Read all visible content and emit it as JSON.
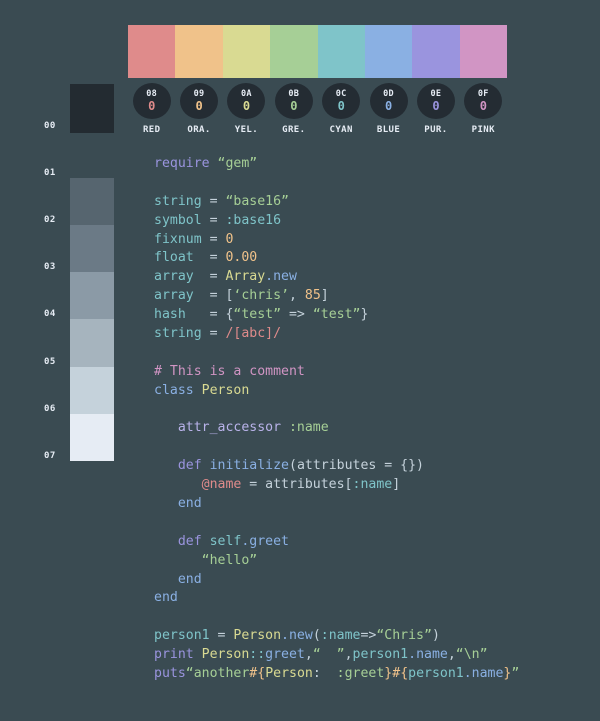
{
  "theme": {
    "background": "#3a4b52",
    "badge_bg": "#242c33",
    "label_color": "#e6ecf4"
  },
  "palette": {
    "accent_swatches": [
      {
        "hex_id": "08",
        "name": "RED",
        "zero": "0",
        "color": "#df8b8b"
      },
      {
        "hex_id": "09",
        "name": "ORA.",
        "zero": "0",
        "color": "#f0c28a"
      },
      {
        "hex_id": "0A",
        "name": "YEL.",
        "zero": "0",
        "color": "#d9da92"
      },
      {
        "hex_id": "0B",
        "name": "GRE.",
        "zero": "0",
        "color": "#a6cf96"
      },
      {
        "hex_id": "0C",
        "name": "CYAN",
        "zero": "0",
        "color": "#7fc4c9"
      },
      {
        "hex_id": "0D",
        "name": "BLUE",
        "zero": "0",
        "color": "#8ab0e3"
      },
      {
        "hex_id": "0E",
        "name": "PUR.",
        "zero": "0",
        "color": "#9a94de"
      },
      {
        "hex_id": "0F",
        "name": "PINK",
        "zero": "0",
        "color": "#d195c4"
      }
    ],
    "grayscale_ramp": [
      {
        "hex_id": "00",
        "color": "#232b31"
      },
      {
        "hex_id": "01",
        "color": "#3a4b52"
      },
      {
        "hex_id": "02",
        "color": "#56656f"
      },
      {
        "hex_id": "03",
        "color": "#6b7a86"
      },
      {
        "hex_id": "04",
        "color": "#8b9aa6"
      },
      {
        "hex_id": "05",
        "color": "#a6b4be"
      },
      {
        "hex_id": "06",
        "color": "#c5d2db"
      },
      {
        "hex_id": "07",
        "color": "#e6ecf4"
      }
    ]
  },
  "code_sample": {
    "language": "ruby",
    "lines": [
      [
        {
          "t": "require ",
          "c": "#9a94de"
        },
        {
          "t": "“gem”",
          "c": "#a6cf96"
        }
      ],
      [],
      [
        {
          "t": "string",
          "c": "#7fc4c9"
        },
        {
          "t": " = ",
          "c": "#c5d2db"
        },
        {
          "t": "“base16”",
          "c": "#a6cf96"
        }
      ],
      [
        {
          "t": "symbol",
          "c": "#7fc4c9"
        },
        {
          "t": " = ",
          "c": "#c5d2db"
        },
        {
          "t": ":base16",
          "c": "#7fc4c9"
        }
      ],
      [
        {
          "t": "fixnum",
          "c": "#7fc4c9"
        },
        {
          "t": " = ",
          "c": "#c5d2db"
        },
        {
          "t": "0",
          "c": "#f0c28a"
        }
      ],
      [
        {
          "t": "float",
          "c": "#7fc4c9"
        },
        {
          "t": "  = ",
          "c": "#c5d2db"
        },
        {
          "t": "0.00",
          "c": "#f0c28a"
        }
      ],
      [
        {
          "t": "array",
          "c": "#7fc4c9"
        },
        {
          "t": "  = ",
          "c": "#c5d2db"
        },
        {
          "t": "Array",
          "c": "#d9da92"
        },
        {
          "t": ".new",
          "c": "#8ab0e3"
        }
      ],
      [
        {
          "t": "array",
          "c": "#7fc4c9"
        },
        {
          "t": "  = [",
          "c": "#c5d2db"
        },
        {
          "t": "‘chris’",
          "c": "#a6cf96"
        },
        {
          "t": ", ",
          "c": "#c5d2db"
        },
        {
          "t": "85",
          "c": "#f0c28a"
        },
        {
          "t": "]",
          "c": "#c5d2db"
        }
      ],
      [
        {
          "t": "hash",
          "c": "#7fc4c9"
        },
        {
          "t": "   = {",
          "c": "#c5d2db"
        },
        {
          "t": "“test”",
          "c": "#a6cf96"
        },
        {
          "t": " => ",
          "c": "#c5d2db"
        },
        {
          "t": "“test”",
          "c": "#a6cf96"
        },
        {
          "t": "}",
          "c": "#c5d2db"
        }
      ],
      [
        {
          "t": "string",
          "c": "#7fc4c9"
        },
        {
          "t": " = ",
          "c": "#c5d2db"
        },
        {
          "t": "/[abc]/",
          "c": "#df8b8b"
        }
      ],
      [],
      [
        {
          "t": "# This is a comment",
          "c": "#d195c4"
        }
      ],
      [
        {
          "t": "class ",
          "c": "#8ab0e3"
        },
        {
          "t": "Person",
          "c": "#d9da92"
        }
      ],
      [],
      [
        {
          "t": "   ",
          "c": "#c5d2db"
        },
        {
          "t": "attr_accessor ",
          "c": "#b9b3ea"
        },
        {
          "t": ":name",
          "c": "#a6cf96"
        }
      ],
      [],
      [
        {
          "t": "   ",
          "c": "#c5d2db"
        },
        {
          "t": "def ",
          "c": "#9a94de"
        },
        {
          "t": "initialize",
          "c": "#8ab0e3"
        },
        {
          "t": "(attributes",
          "c": "#c5d2db"
        },
        {
          "t": " = ",
          "c": "#c5d2db"
        },
        {
          "t": "{})",
          "c": "#c5d2db"
        }
      ],
      [
        {
          "t": "      ",
          "c": "#c5d2db"
        },
        {
          "t": "@name",
          "c": "#df8b8b"
        },
        {
          "t": " = attributes[",
          "c": "#c5d2db"
        },
        {
          "t": ":name",
          "c": "#7fc4c9"
        },
        {
          "t": "]",
          "c": "#c5d2db"
        }
      ],
      [
        {
          "t": "   ",
          "c": "#c5d2db"
        },
        {
          "t": "end",
          "c": "#8ab0e3"
        }
      ],
      [],
      [
        {
          "t": "   ",
          "c": "#c5d2db"
        },
        {
          "t": "def ",
          "c": "#9a94de"
        },
        {
          "t": "self",
          "c": "#7fc4c9"
        },
        {
          "t": ".greet",
          "c": "#8ab0e3"
        }
      ],
      [
        {
          "t": "      ",
          "c": "#c5d2db"
        },
        {
          "t": "“hello”",
          "c": "#a6cf96"
        }
      ],
      [
        {
          "t": "   ",
          "c": "#c5d2db"
        },
        {
          "t": "end",
          "c": "#8ab0e3"
        }
      ],
      [
        {
          "t": "end",
          "c": "#8ab0e3"
        }
      ],
      [],
      [
        {
          "t": "person1",
          "c": "#7fc4c9"
        },
        {
          "t": " = ",
          "c": "#c5d2db"
        },
        {
          "t": "Person",
          "c": "#d9da92"
        },
        {
          "t": ".new",
          "c": "#8ab0e3"
        },
        {
          "t": "(",
          "c": "#c5d2db"
        },
        {
          "t": ":name",
          "c": "#7fc4c9"
        },
        {
          "t": "=>",
          "c": "#c5d2db"
        },
        {
          "t": "“Chris”",
          "c": "#a6cf96"
        },
        {
          "t": ")",
          "c": "#c5d2db"
        }
      ],
      [
        {
          "t": "print ",
          "c": "#9a94de"
        },
        {
          "t": "Person",
          "c": "#d9da92"
        },
        {
          "t": "::",
          "c": "#7fc4c9"
        },
        {
          "t": "greet",
          "c": "#8ab0e3"
        },
        {
          "t": ",",
          "c": "#c5d2db"
        },
        {
          "t": "“  ”",
          "c": "#a6cf96"
        },
        {
          "t": ",",
          "c": "#c5d2db"
        },
        {
          "t": "person1",
          "c": "#7fc4c9"
        },
        {
          "t": ".name",
          "c": "#8ab0e3"
        },
        {
          "t": ",",
          "c": "#c5d2db"
        },
        {
          "t": "“\\n”",
          "c": "#a6cf96"
        }
      ],
      [
        {
          "t": "puts",
          "c": "#9a94de"
        },
        {
          "t": "“another",
          "c": "#a6cf96"
        },
        {
          "t": "#{",
          "c": "#f0c28a"
        },
        {
          "t": "Person",
          "c": "#d9da92"
        },
        {
          "t": ":  ",
          "c": "#c5d2db"
        },
        {
          "t": ":greet",
          "c": "#a6cf96"
        },
        {
          "t": "}",
          "c": "#f0c28a"
        },
        {
          "t": "#{",
          "c": "#f0c28a"
        },
        {
          "t": "person1",
          "c": "#7fc4c9"
        },
        {
          "t": ".name",
          "c": "#8ab0e3"
        },
        {
          "t": "}",
          "c": "#f0c28a"
        },
        {
          "t": "”",
          "c": "#a6cf96"
        }
      ]
    ]
  }
}
